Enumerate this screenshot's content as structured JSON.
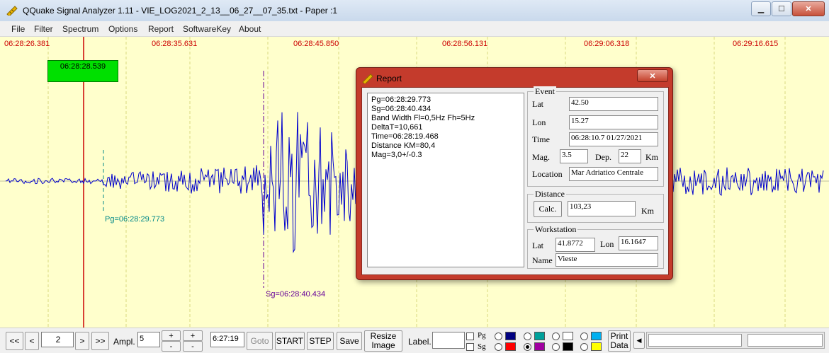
{
  "window": {
    "title": "QQuake Signal Analyzer 1.11  -  VIE_LOG2021_2_13__06_27__07_35.txt - Paper :1",
    "minimize_glyph": "▁",
    "maximize_glyph": "☐",
    "close_glyph": "✕"
  },
  "menu": [
    "File",
    "Filter",
    "Spectrum",
    "Options",
    "Report",
    "SoftwareKey",
    "About"
  ],
  "plot": {
    "time_labels": [
      "06:28:26.381",
      "06:28:35.631",
      "06:28:45.850",
      "06:28:56.131",
      "06:29:06.318",
      "06:29:16.615"
    ],
    "marker_time": "06:28:28.539",
    "pg_label": "Pg=06:28:29.773",
    "sg_label": "Sg=06:28:40.434",
    "background_color": "#ffffcc",
    "signal_color": "#0000cc",
    "pg_color": "#008888",
    "sg_color": "#660099"
  },
  "report_dialog": {
    "title": "Report",
    "close_glyph": "✕",
    "lines": [
      "Pg=06:28:29.773",
      "Sg=06:28:40.434",
      "Band Width Fl=0,5Hz Fh=5Hz",
      "DeltaT=10,661",
      "Time=06:28:19.468",
      "Distance KM=80,4",
      "Mag=3,0+/-0.3"
    ],
    "event": {
      "title": "Event",
      "lat_label": "Lat",
      "lat": "42.50",
      "lon_label": "Lon",
      "lon": "15.27",
      "time_label": "Time",
      "time": "06:28:10.7 01/27/2021",
      "mag_label": "Mag.",
      "mag": "3.5",
      "dep_label": "Dep.",
      "dep": "22",
      "km_label": "Km",
      "location_label": "Location",
      "location": "Mar Adriatico Centrale"
    },
    "distance": {
      "title": "Distance",
      "calc_label": "Calc.",
      "value": "103,23",
      "km_label": "Km"
    },
    "workstation": {
      "title": "Workstation",
      "lat_label": "Lat",
      "lat": "41.8772",
      "lon_label": "Lon",
      "lon": "16.1647",
      "name_label": "Name",
      "name": "Vieste"
    }
  },
  "toolbar": {
    "first": "<<",
    "prev": "<",
    "page": "2",
    "next": ">",
    "last": ">>",
    "ampl_label": "Ampl.",
    "ampl_value": "5",
    "plus": "+",
    "minus": "-",
    "time_value": "6:27:19",
    "goto": "Goto",
    "start": "START",
    "step": "STEP",
    "save": "Save",
    "resize_line1": "Resize",
    "resize_line2": "Image",
    "label": "Label.",
    "pg": "Pg",
    "sg": "Sg",
    "print_line1": "Print",
    "print_line2": "Data",
    "scroll_left_glyph": "◀",
    "colors": [
      "#000080",
      "#00a09a",
      "#ffffff",
      "#00b0f0",
      "#ff0000",
      "#a000a0",
      "#000000",
      "#ffff00"
    ]
  }
}
